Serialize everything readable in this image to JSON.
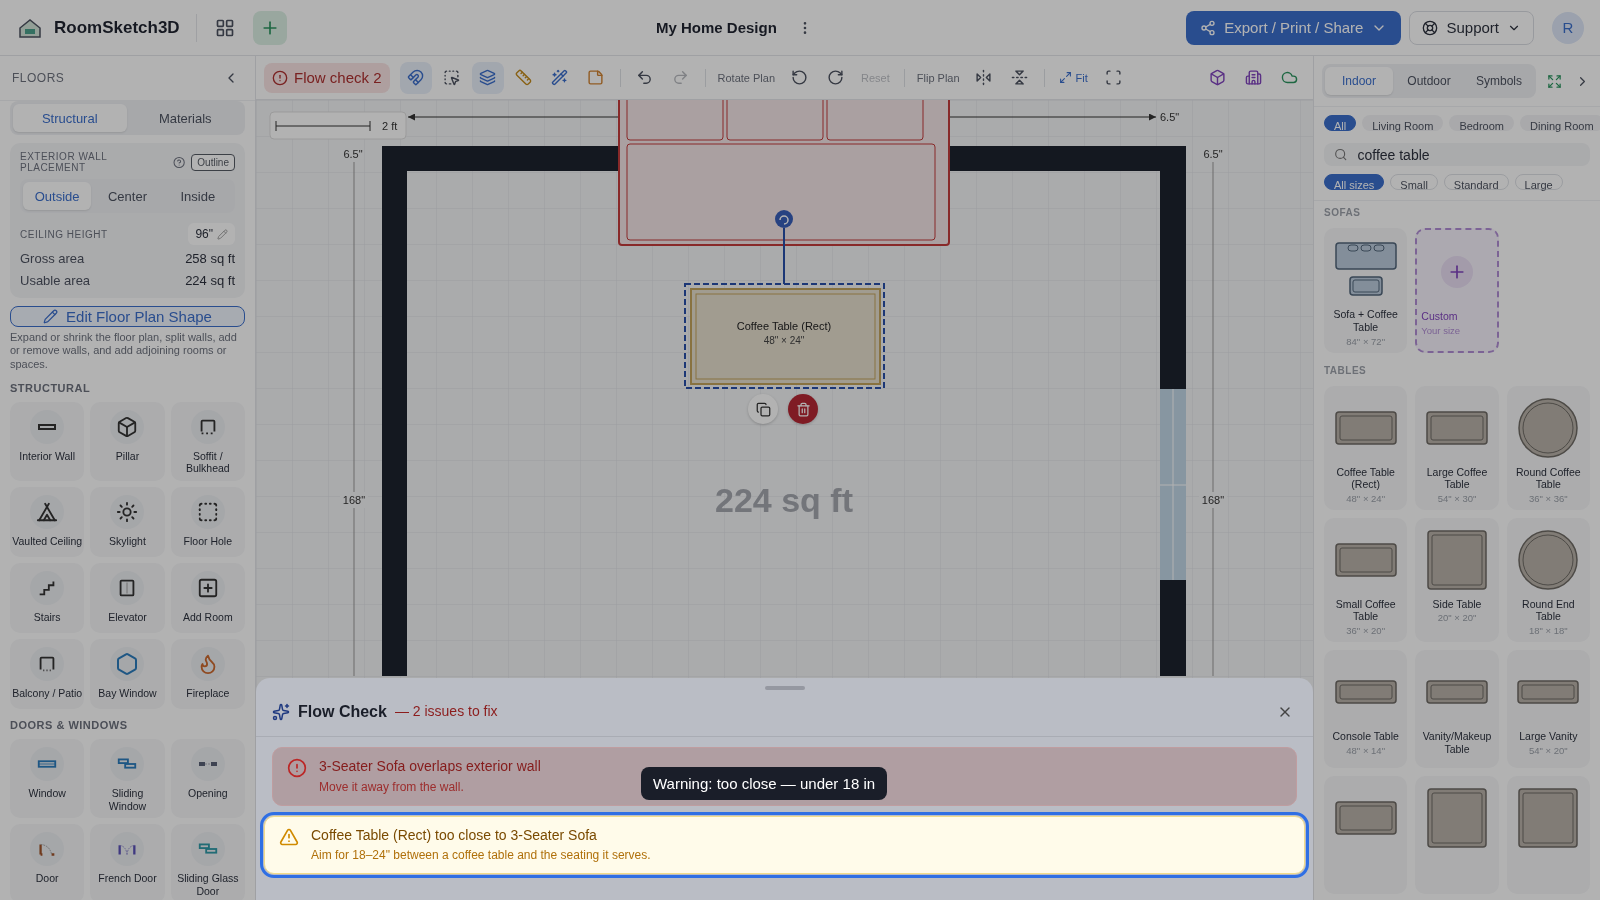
{
  "header": {
    "app_name": "RoomSketch3D",
    "project_title": "My Home Design",
    "export_button": "Export / Print / Share",
    "support_button": "Support",
    "avatar": "R"
  },
  "left_panel": {
    "title": "FLOORS",
    "tabs": [
      {
        "label": "Structural",
        "selected": true
      },
      {
        "label": "Materials",
        "selected": false
      }
    ],
    "wall_placement": {
      "label": "EXTERIOR WALL PLACEMENT",
      "outline_button": "Outline",
      "options": [
        {
          "label": "Outside",
          "selected": true
        },
        {
          "label": "Center",
          "selected": false
        },
        {
          "label": "Inside",
          "selected": false
        }
      ]
    },
    "ceiling": {
      "label": "CEILING HEIGHT",
      "value": "96\""
    },
    "areas": [
      {
        "label": "Gross area",
        "value": "258 sq ft"
      },
      {
        "label": "Usable area",
        "value": "224 sq ft"
      }
    ],
    "edit_button": "Edit Floor Plan Shape",
    "edit_hint": "Expand or shrink the floor plan, split walls, add or remove walls, and add adjoining rooms or spaces.",
    "sections": [
      {
        "title": "STRUCTURAL",
        "items": [
          {
            "label": "Interior Wall"
          },
          {
            "label": "Pillar"
          },
          {
            "label": "Soffit / Bulkhead"
          },
          {
            "label": "Vaulted Ceiling"
          },
          {
            "label": "Skylight"
          },
          {
            "label": "Floor Hole"
          },
          {
            "label": "Stairs"
          },
          {
            "label": "Elevator"
          },
          {
            "label": "Add Room"
          },
          {
            "label": "Balcony / Patio"
          },
          {
            "label": "Bay Window"
          },
          {
            "label": "Fireplace"
          }
        ]
      },
      {
        "title": "DOORS & WINDOWS",
        "items": [
          {
            "label": "Window"
          },
          {
            "label": "Sliding Window"
          },
          {
            "label": "Opening"
          },
          {
            "label": "Door"
          },
          {
            "label": "French Door"
          },
          {
            "label": "Sliding Glass Door"
          }
        ]
      }
    ]
  },
  "toolbar": {
    "flow_check_button": "Flow check 2",
    "rotate_label": "Rotate Plan",
    "reset_button": {
      "label": "Reset",
      "disabled": true
    },
    "redo_disabled": true,
    "flip_label": "Flip Plan",
    "fit_button": "Fit"
  },
  "canvas": {
    "scale_label": "2 ft",
    "top_dimension": "6.5\"",
    "left_offset": "6.5\"",
    "right_offset": "6.5\"",
    "left_length": "168\"",
    "right_length": "168\"",
    "area_label": "224 sq ft",
    "selected_item": {
      "name": "Coffee Table (Rect)",
      "size": "48\" × 24\""
    }
  },
  "flow_check": {
    "title": "Flow Check",
    "summary": "— 2 issues to fix",
    "tooltip": "Warning: too close — under 18 in",
    "issues": [
      {
        "kind": "error",
        "title": "3-Seater Sofa overlaps exterior wall",
        "message": "Move it away from the wall.",
        "highlighted": false
      },
      {
        "kind": "warning",
        "title": "Coffee Table (Rect) too close to 3-Seater Sofa",
        "message": "Aim for 18–24\" between a coffee table and the seating it serves.",
        "highlighted": true
      }
    ]
  },
  "right_panel": {
    "tabs": [
      {
        "label": "Indoor",
        "selected": true
      },
      {
        "label": "Outdoor",
        "selected": false
      },
      {
        "label": "Symbols",
        "selected": false
      }
    ],
    "rooms": [
      {
        "label": "All",
        "selected": true
      },
      {
        "label": "Living Room",
        "selected": false
      },
      {
        "label": "Bedroom",
        "selected": false
      },
      {
        "label": "Dining Room",
        "selected": false
      }
    ],
    "search": {
      "value": "coffee table"
    },
    "sizes": [
      {
        "label": "All sizes",
        "selected": true
      },
      {
        "label": "Small",
        "selected": false
      },
      {
        "label": "Standard",
        "selected": false
      },
      {
        "label": "Large",
        "selected": false
      }
    ],
    "groups": [
      {
        "title": "SOFAS",
        "items": [
          {
            "kind": "sofa",
            "name": "Sofa + Coffee Table",
            "size": "84\" × 72\""
          },
          {
            "kind": "custom",
            "name": "Custom",
            "size": "Your size"
          }
        ]
      },
      {
        "title": "TABLES",
        "items": [
          {
            "kind": "rect",
            "name": "Coffee Table (Rect)",
            "size": "48\" × 24\""
          },
          {
            "kind": "rect",
            "name": "Large Coffee Table",
            "size": "54\" × 30\""
          },
          {
            "kind": "round",
            "name": "Round Coffee Table",
            "size": "36\" × 36\""
          },
          {
            "kind": "rect",
            "name": "Small Coffee Table",
            "size": "36\" × 20\""
          },
          {
            "kind": "square",
            "name": "Side Table",
            "size": "20\" × 20\""
          },
          {
            "kind": "round",
            "name": "Round End Table",
            "size": "18\" × 18\""
          },
          {
            "kind": "slim",
            "name": "Console Table",
            "size": "48\" × 14\""
          },
          {
            "kind": "slim",
            "name": "Vanity/Makeup Table"
          },
          {
            "kind": "slim",
            "name": "Large Vanity",
            "size": "54\" × 20\""
          },
          {
            "kind": "rect"
          },
          {
            "kind": "square"
          },
          {
            "kind": "square"
          }
        ]
      }
    ]
  }
}
